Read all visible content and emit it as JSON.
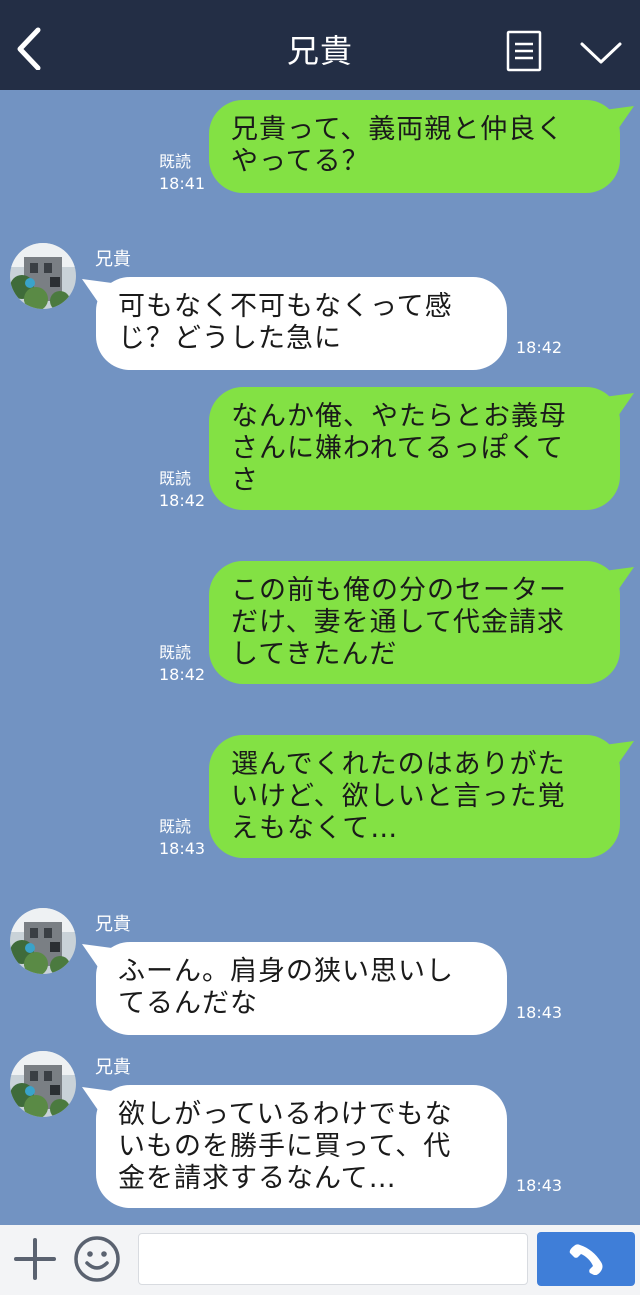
{
  "header": {
    "title": "兄貴",
    "back_icon": "chevron-left-icon",
    "menu_icon": "notes-icon",
    "collapse_icon": "chevron-down-icon"
  },
  "colors": {
    "header_bg": "#232e45",
    "chat_bg": "#7293c2",
    "outgoing_bubble": "#83e144",
    "incoming_bubble": "#ffffff",
    "send_button": "#3f7ed8"
  },
  "messages": [
    {
      "direction": "out",
      "lines": [
        "兄貴って、義両親と仲良く",
        "やってる？"
      ],
      "read": "既読",
      "time": "18:41"
    },
    {
      "direction": "in",
      "sender": "兄貴",
      "lines": [
        "可もなく不可もなくって感",
        "じ？どうした急に"
      ],
      "time": "18:42"
    },
    {
      "direction": "out",
      "lines": [
        "なんか俺、やたらとお義母",
        "さんに嫌われてるっぽくて",
        "さ"
      ],
      "read": "既読",
      "time": "18:42"
    },
    {
      "direction": "out",
      "lines": [
        "この前も俺の分のセーター",
        "だけ、妻を通して代金請求",
        "してきたんだ"
      ],
      "read": "既読",
      "time": "18:42"
    },
    {
      "direction": "out",
      "lines": [
        "選んでくれたのはありがた",
        "いけど、欲しいと言った覚",
        "えもなくて…"
      ],
      "read": "既読",
      "time": "18:43"
    },
    {
      "direction": "in",
      "sender": "兄貴",
      "lines": [
        "ふーん。肩身の狭い思いし",
        "てるんだな"
      ],
      "time": "18:43"
    },
    {
      "direction": "in",
      "sender": "兄貴",
      "lines": [
        "欲しがっているわけでもな",
        "いものを勝手に買って、代",
        "金を請求するなんて…"
      ],
      "time": "18:43"
    }
  ],
  "footer": {
    "plus_icon": "plus-icon",
    "emoji_icon": "smiley-icon",
    "input_value": "",
    "input_placeholder": "",
    "call_icon": "phone-icon"
  }
}
